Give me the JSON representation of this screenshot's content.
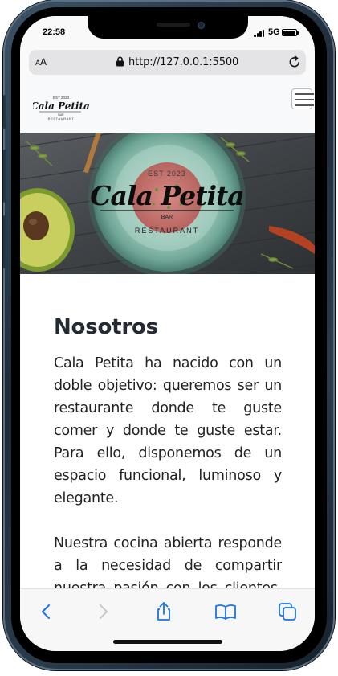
{
  "status_bar": {
    "time": "22:58",
    "network": "5G"
  },
  "browser": {
    "text_size_label_small": "A",
    "text_size_label_large": "A",
    "url": "http://127.0.0.1:5500",
    "icons": {
      "lock": "lock-icon",
      "reload": "reload-icon",
      "back": "back-arrow-icon",
      "forward": "forward-arrow-icon",
      "share": "share-icon",
      "bookmarks": "book-icon",
      "tabs": "tabs-icon"
    },
    "accent_color": "#1a73e8"
  },
  "site": {
    "logo": {
      "name": "Cala Petita",
      "est": "EST 2023",
      "sub": "BAR",
      "tagline": "RESTAURANT"
    },
    "hero_logo": {
      "name": "Cala Petita",
      "est": "EST 2023",
      "sub": "BAR",
      "tagline": "RESTAURANT"
    },
    "section_title": "Nosotros",
    "paragraphs": [
      "Cala Petita ha nacido con un doble objetivo: queremos ser un restaurante donde te guste comer y donde te guste estar. Para ello, disponemos de un espacio funcional, luminoso y elegante.",
      "Nuestra cocina abierta responde a la necesidad de compartir nuestra pasión con los clientes. Nos gusta"
    ]
  }
}
